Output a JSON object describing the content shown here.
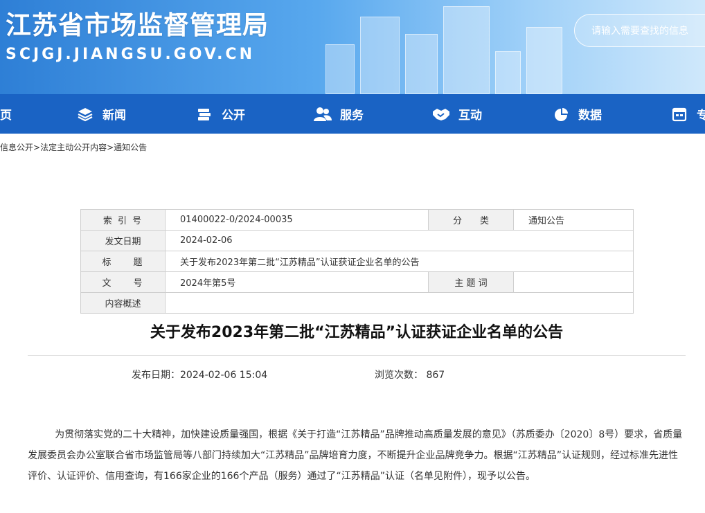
{
  "header": {
    "title": "江苏省市场监督管理局",
    "domain": "SCJGJ.JIANGSU.GOV.CN",
    "search_placeholder": "请输入需要查找的信息"
  },
  "nav": {
    "items": [
      {
        "label": "页",
        "icon": "home-icon"
      },
      {
        "label": "新闻",
        "icon": "layers-icon"
      },
      {
        "label": "公开",
        "icon": "stack-icon"
      },
      {
        "label": "服务",
        "icon": "people-icon"
      },
      {
        "label": "互动",
        "icon": "handshake-icon"
      },
      {
        "label": "数据",
        "icon": "pie-chart-icon"
      },
      {
        "label": "专",
        "icon": "calendar-icon"
      }
    ]
  },
  "breadcrumb": [
    "信息公开",
    "法定主动公开内容",
    "通知公告"
  ],
  "meta": {
    "index_label": "索 引 号",
    "index_value": "01400022-0/2024-00035",
    "category_label": "分　　类",
    "category_value": "通知公告",
    "date_label": "发文日期",
    "date_value": "2024-02-06",
    "title_label": "标　　题",
    "title_value": "关于发布2023年第二批“江苏精品”认证获证企业名单的公告",
    "docno_label": "文　　号",
    "docno_value": "2024年第5号",
    "keywords_label": "主 题 词",
    "keywords_value": "",
    "summary_label": "内容概述",
    "summary_value": ""
  },
  "article": {
    "title": "关于发布2023年第二批“江苏精品”认证获证企业名单的公告",
    "published_label": "发布日期：",
    "published_value": "2024-02-06 15:04",
    "views_label": "浏览次数：",
    "views_value": "867",
    "body": "为贯彻落实党的二十大精神，加快建设质量强国，根据《关于打造“江苏精品”品牌推动高质量发展的意见》（苏质委办〔2020〕8号）要求，省质量发展委员会办公室联合省市场监管局等八部门持续加大“江苏精品”品牌培育力度，不断提升企业品牌竞争力。根据“江苏精品”认证规则，经过标准先进性评价、认证评价、信用查询，有166家企业的166个产品（服务）通过了“江苏精品”认证（名单见附件），现予以公告。"
  },
  "colors": {
    "nav_bg": "#1a63c4",
    "banner_start": "#2e7fd6",
    "banner_end": "#cfe8fb"
  }
}
